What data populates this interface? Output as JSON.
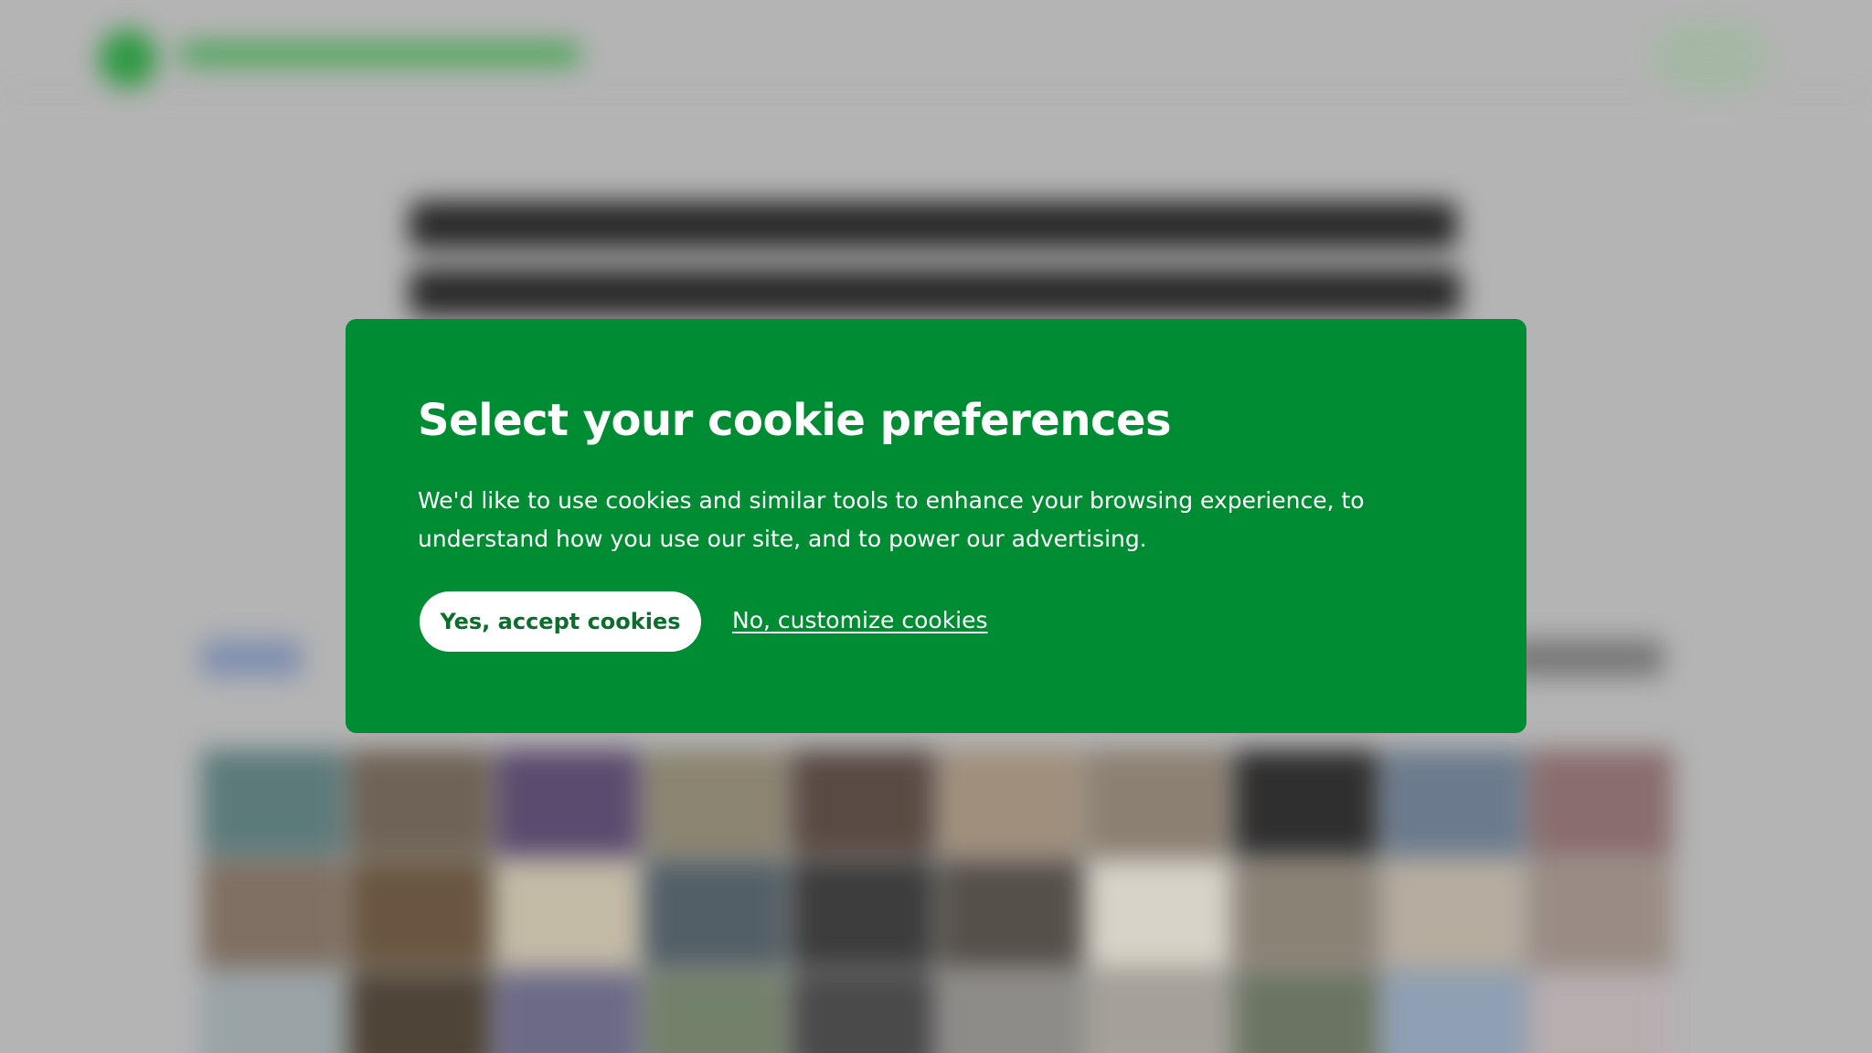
{
  "cookie_dialog": {
    "title": "Select your cookie preferences",
    "body": "We'd like to use cookies and similar tools to enhance your browsing experience, to understand how you use our site, and to power our advertising.",
    "accept_label": "Yes, accept cookies",
    "customize_label": "No, customize cookies"
  },
  "colors": {
    "dialog_background": "#008c33",
    "dialog_text": "#ffffff",
    "accept_text": "#0b6e2c",
    "overlay": "#b4b4b4"
  }
}
